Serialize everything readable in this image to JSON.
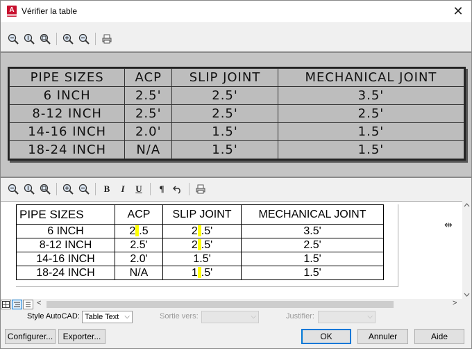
{
  "window": {
    "title": "Vérifier la table",
    "app_icon_letter": "A"
  },
  "preview_table": {
    "rows": [
      [
        "PIPE SIZES",
        "ACP",
        "SLIP JOINT",
        "MECHANICAL JOINT"
      ],
      [
        "6 INCH",
        "2.5'",
        "2.5'",
        "3.5'"
      ],
      [
        "8-12 INCH",
        "2.5'",
        "2.5'",
        "2.5'"
      ],
      [
        "14-16 INCH",
        "2.0'",
        "1.5'",
        "1.5'"
      ],
      [
        "18-24 INCH",
        "N/A",
        "1.5'",
        "1.5'"
      ]
    ]
  },
  "editor_table": {
    "rows": [
      [
        "PIPE SIZES",
        "ACP",
        "SLIP JOINT",
        "MECHANICAL JOINT"
      ],
      [
        "6 INCH",
        "2.5",
        "2.5'",
        "3.5'"
      ],
      [
        "8-12 INCH",
        "2.5'",
        "2.5'",
        "2.5'"
      ],
      [
        "14-16 INCH",
        "2.0'",
        "1.5'",
        "1.5'"
      ],
      [
        "18-24 INCH",
        "N/A",
        "1.5'",
        "1.5'"
      ]
    ]
  },
  "toolbar2": {
    "bold": "B",
    "italic": "I",
    "underline": "U",
    "pilcrow": "¶"
  },
  "options": {
    "style_label": "Style AutoCAD:",
    "style_value": "Table Text",
    "output_label": "Sortie vers:",
    "justify_label": "Justifier:"
  },
  "buttons": {
    "configure": "Configurer...",
    "export": "Exporter...",
    "ok": "OK",
    "cancel": "Annuler",
    "help": "Aide"
  },
  "colors": {
    "highlight": "#ffff00",
    "accent": "#0078d7",
    "app_red": "#c8102e"
  }
}
